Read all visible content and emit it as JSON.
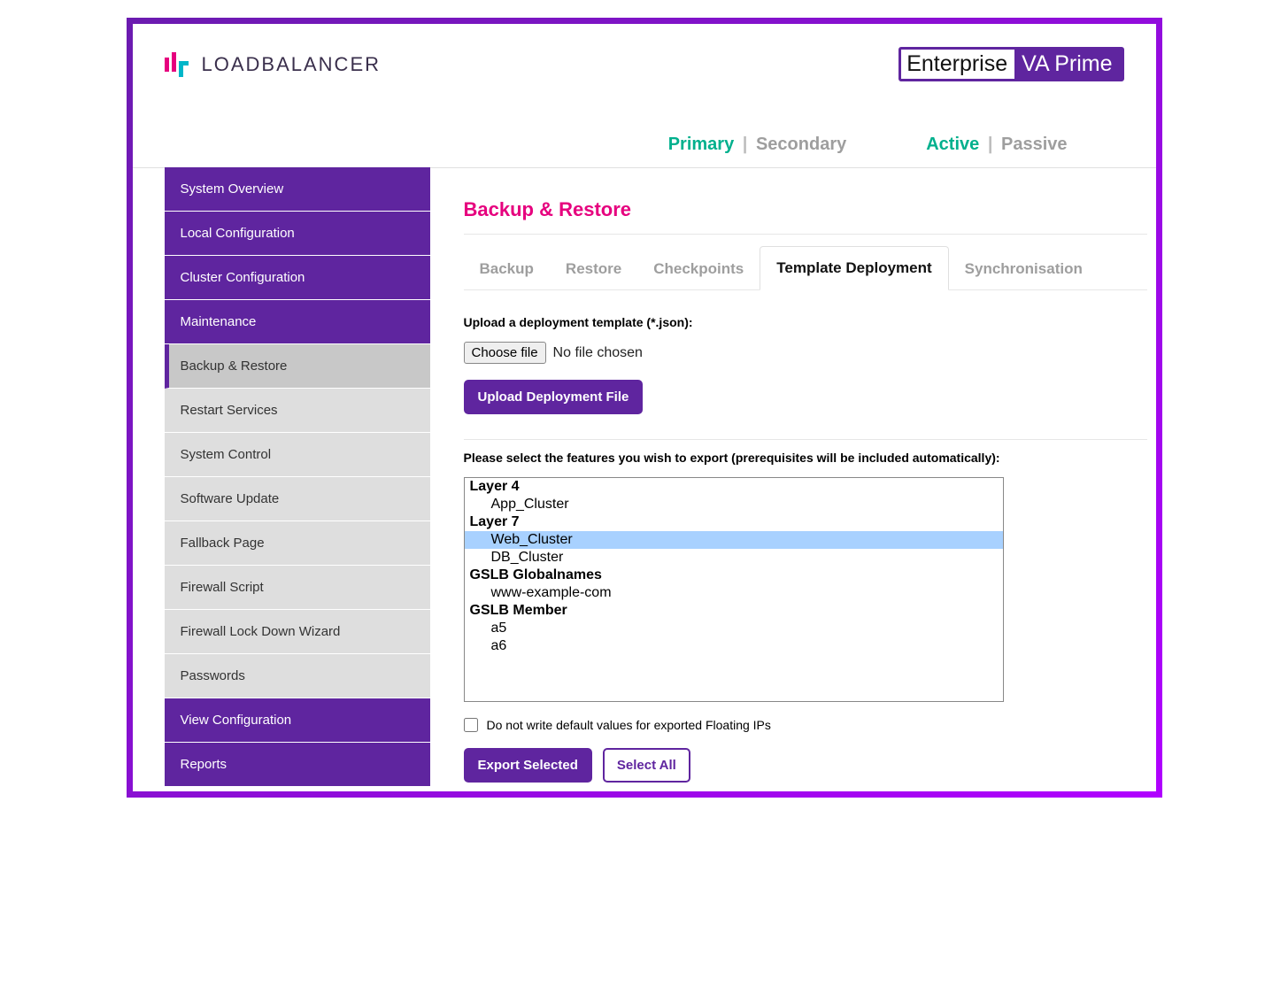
{
  "brand": {
    "name": "LOADBALANCER",
    "badge_left": "Enterprise",
    "badge_right": "VA Prime"
  },
  "status": {
    "primary": "Primary",
    "secondary": "Secondary",
    "active": "Active",
    "passive": "Passive"
  },
  "sidebar": {
    "items": [
      {
        "label": "System Overview",
        "type": "top"
      },
      {
        "label": "Local Configuration",
        "type": "top"
      },
      {
        "label": "Cluster Configuration",
        "type": "top"
      },
      {
        "label": "Maintenance",
        "type": "top"
      },
      {
        "label": "Backup & Restore",
        "type": "sub",
        "active": true
      },
      {
        "label": "Restart Services",
        "type": "sub"
      },
      {
        "label": "System Control",
        "type": "sub"
      },
      {
        "label": "Software Update",
        "type": "sub"
      },
      {
        "label": "Fallback Page",
        "type": "sub"
      },
      {
        "label": "Firewall Script",
        "type": "sub"
      },
      {
        "label": "Firewall Lock Down Wizard",
        "type": "sub"
      },
      {
        "label": "Passwords",
        "type": "sub"
      },
      {
        "label": "View Configuration",
        "type": "top"
      },
      {
        "label": "Reports",
        "type": "top"
      }
    ]
  },
  "page": {
    "title": "Backup & Restore",
    "tabs": [
      {
        "label": "Backup"
      },
      {
        "label": "Restore"
      },
      {
        "label": "Checkpoints"
      },
      {
        "label": "Template Deployment",
        "active": true
      },
      {
        "label": "Synchronisation"
      }
    ],
    "upload_label": "Upload a deployment template (*.json):",
    "choose_file": "Choose file",
    "no_file": "No file chosen",
    "upload_button": "Upload Deployment File",
    "export_label": "Please select the features you wish to export (prerequisites will be included automatically):",
    "features": [
      {
        "label": "Layer 4",
        "group": true
      },
      {
        "label": "App_Cluster"
      },
      {
        "label": "Layer 7",
        "group": true
      },
      {
        "label": "Web_Cluster",
        "selected": true
      },
      {
        "label": "DB_Cluster"
      },
      {
        "label": "GSLB Globalnames",
        "group": true
      },
      {
        "label": "www-example-com"
      },
      {
        "label": "GSLB Member",
        "group": true
      },
      {
        "label": "a5"
      },
      {
        "label": "a6"
      }
    ],
    "checkbox_label": "Do not write default values for exported Floating IPs",
    "export_button": "Export Selected",
    "select_all_button": "Select All"
  }
}
